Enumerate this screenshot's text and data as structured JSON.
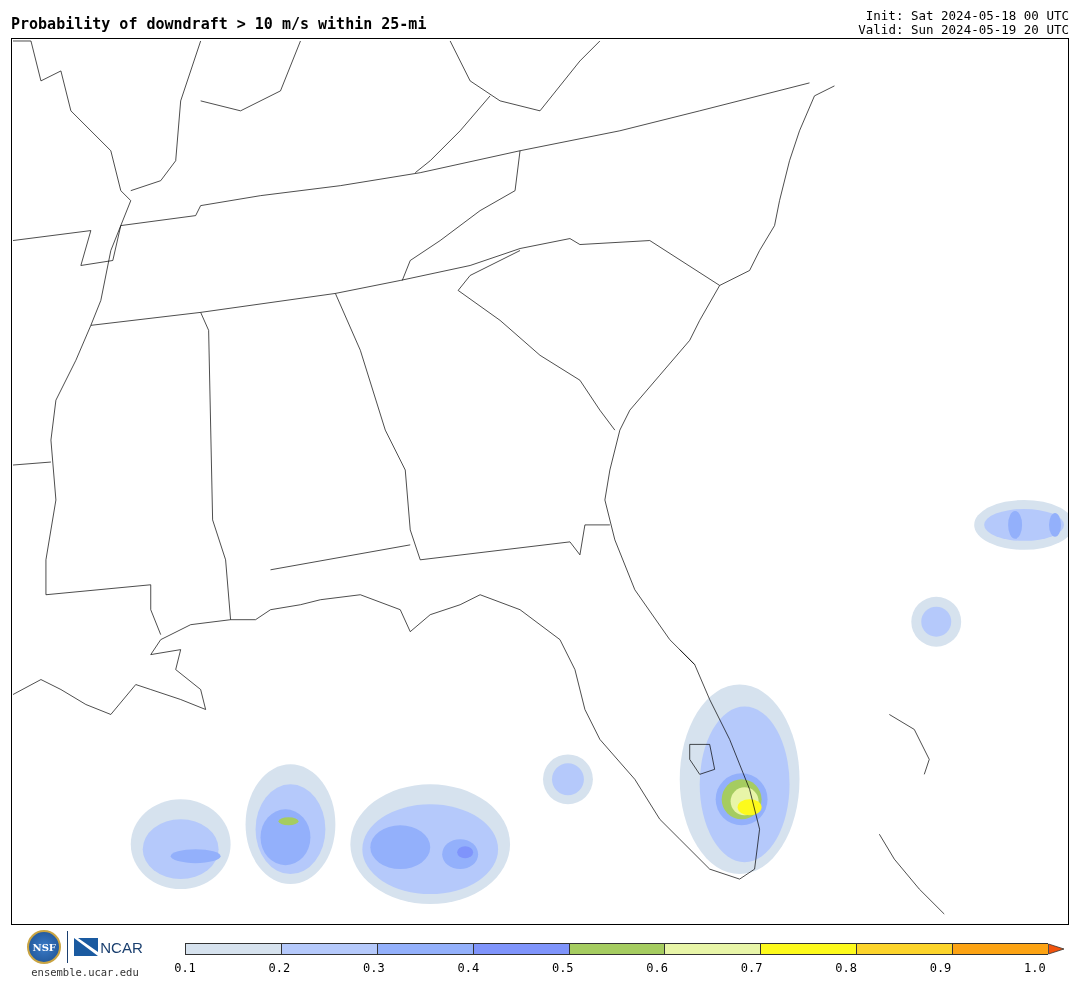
{
  "title": "Probability of downdraft > 10 m/s within 25-mi",
  "init": "Init: Sat 2024-05-18 00 UTC",
  "valid": "Valid: Sun 2024-05-19 20 UTC",
  "logos": {
    "seal": "NSF",
    "org": "NCAR"
  },
  "website": "ensemble.ucar.edu",
  "colorbar": {
    "segments": [
      {
        "color": "#d6e2ee"
      },
      {
        "color": "#b5c9fb"
      },
      {
        "color": "#93b0fb"
      },
      {
        "color": "#7f94fb"
      },
      {
        "color": "#a5cc60"
      },
      {
        "color": "#e8f5a8"
      },
      {
        "color": "#fdfa1c"
      },
      {
        "color": "#fcd42b"
      },
      {
        "color": "#fca313"
      },
      {
        "color": "#f2530c",
        "kind": "arrow"
      }
    ],
    "ticks": [
      "0.1",
      "0.2",
      "0.3",
      "0.4",
      "0.5",
      "0.6",
      "0.7",
      "0.8",
      "0.9",
      "1.0"
    ]
  }
}
